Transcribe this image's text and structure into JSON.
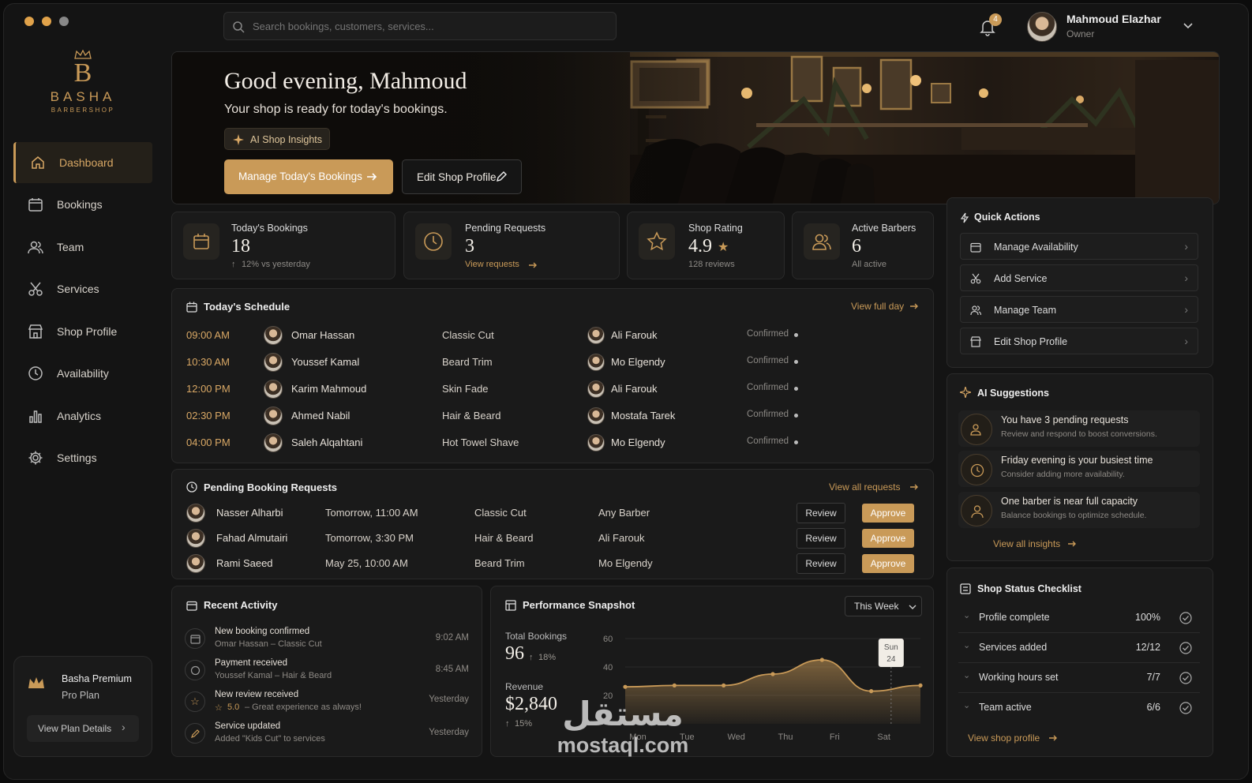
{
  "search": {
    "placeholder": "Search bookings, customers, services..."
  },
  "notifications": {
    "count": "4"
  },
  "user": {
    "name": "Mahmoud Elazhar",
    "role": "Owner"
  },
  "brand": {
    "letter": "B",
    "name": "BASHA",
    "sub": "BARBERSHOP"
  },
  "sidebar": {
    "items": [
      {
        "label": "Dashboard",
        "icon": "home-icon"
      },
      {
        "label": "Bookings",
        "icon": "calendar-icon"
      },
      {
        "label": "Team",
        "icon": "users-icon"
      },
      {
        "label": "Services",
        "icon": "scissors-icon"
      },
      {
        "label": "Shop Profile",
        "icon": "store-icon"
      },
      {
        "label": "Availability",
        "icon": "clock-icon"
      },
      {
        "label": "Analytics",
        "icon": "bar-chart-icon"
      },
      {
        "label": "Settings",
        "icon": "gear-icon"
      }
    ]
  },
  "plan": {
    "name": "Basha Premium",
    "tier": "Pro Plan",
    "button": "View Plan Details"
  },
  "hero": {
    "greeting": "Good evening, Mahmoud",
    "subtitle": "Your shop is ready for today's bookings.",
    "insights": "AI Shop Insights",
    "primary": "Manage Today's Bookings",
    "secondary": "Edit Shop Profile"
  },
  "stats": [
    {
      "label": "Today's Bookings",
      "value": "18",
      "note": "12% vs yesterday"
    },
    {
      "label": "Pending Requests",
      "value": "3",
      "note": "View requests"
    },
    {
      "label": "Shop Rating",
      "value": "4.9",
      "note": "128 reviews"
    },
    {
      "label": "Active Barbers",
      "value": "6",
      "note": "All active"
    }
  ],
  "schedule": {
    "title": "Today's Schedule",
    "link": "View full day",
    "rows": [
      {
        "time": "09:00 AM",
        "customer": "Omar Hassan",
        "service": "Classic Cut",
        "barber": "Ali Farouk",
        "status": "Confirmed"
      },
      {
        "time": "10:30 AM",
        "customer": "Youssef Kamal",
        "service": "Beard Trim",
        "barber": "Mo Elgendy",
        "status": "Confirmed"
      },
      {
        "time": "12:00 PM",
        "customer": "Karim Mahmoud",
        "service": "Skin Fade",
        "barber": "Ali Farouk",
        "status": "Confirmed"
      },
      {
        "time": "02:30 PM",
        "customer": "Ahmed Nabil",
        "service": "Hair & Beard",
        "barber": "Mostafa Tarek",
        "status": "Confirmed"
      },
      {
        "time": "04:00 PM",
        "customer": "Saleh Alqahtani",
        "service": "Hot Towel Shave",
        "barber": "Mo Elgendy",
        "status": "Confirmed"
      }
    ]
  },
  "pending": {
    "title": "Pending Booking Requests",
    "link": "View all requests",
    "review": "Review",
    "approve": "Approve",
    "rows": [
      {
        "name": "Nasser Alharbi",
        "when": "Tomorrow, 11:00 AM",
        "service": "Classic Cut",
        "barber": "Any Barber"
      },
      {
        "name": "Fahad Almutairi",
        "when": "Tomorrow, 3:30 PM",
        "service": "Hair & Beard",
        "barber": "Ali Farouk"
      },
      {
        "name": "Rami Saeed",
        "when": "May 25, 10:00 AM",
        "service": "Beard Trim",
        "barber": "Mo Elgendy"
      }
    ]
  },
  "activity": {
    "title": "Recent Activity",
    "items": [
      {
        "title": "New booking confirmed",
        "detail": "Omar Hassan – Classic Cut",
        "time": "9:02 AM"
      },
      {
        "title": "Payment received",
        "detail": "Youssef Kamal – Hair & Beard",
        "time": "8:45 AM"
      },
      {
        "title": "New review received",
        "rating": "5.0",
        "detail": "– Great experience as always!",
        "time": "Yesterday"
      },
      {
        "title": "Service updated",
        "detail": "Added \"Kids Cut\" to services",
        "time": "Yesterday"
      }
    ]
  },
  "performance": {
    "title": "Performance Snapshot",
    "range": "This Week",
    "bookings_label": "Total Bookings",
    "bookings_value": "96",
    "bookings_change": "18%",
    "revenue_label": "Revenue",
    "revenue_value": "$2,840",
    "revenue_change": "15%",
    "tooltip_day": "Sun",
    "tooltip_date": "24"
  },
  "chart_data": {
    "type": "area",
    "categories": [
      "Mon",
      "Tue",
      "Wed",
      "Thu",
      "Fri",
      "Sat",
      "Sun"
    ],
    "yticks": [
      "60",
      "40",
      "20"
    ],
    "ylim": [
      0,
      60
    ],
    "values": [
      26,
      27,
      27,
      35,
      45,
      23,
      27
    ],
    "accent": "#c99a58"
  },
  "quick_actions": {
    "title": "Quick Actions",
    "items": [
      {
        "label": "Manage Availability"
      },
      {
        "label": "Add Service"
      },
      {
        "label": "Manage Team"
      },
      {
        "label": "Edit Shop Profile"
      }
    ]
  },
  "suggestions": {
    "title": "AI Suggestions",
    "items": [
      {
        "title": "You have 3 pending requests",
        "detail": "Review and respond to boost conversions."
      },
      {
        "title": "Friday evening is your busiest time",
        "detail": "Consider adding more availability."
      },
      {
        "title": "One barber is near full capacity",
        "detail": "Balance bookings to optimize schedule."
      }
    ],
    "link": "View all insights"
  },
  "checklist": {
    "title": "Shop Status Checklist",
    "items": [
      {
        "label": "Profile complete",
        "value": "100%"
      },
      {
        "label": "Services added",
        "value": "12/12"
      },
      {
        "label": "Working hours set",
        "value": "7/7"
      },
      {
        "label": "Team active",
        "value": "6/6"
      }
    ],
    "link": "View shop profile"
  },
  "watermark": {
    "text": "مستقل",
    "domain": "mostaql.com"
  }
}
